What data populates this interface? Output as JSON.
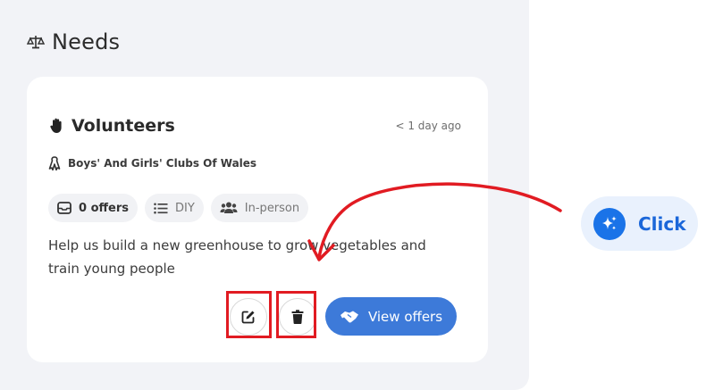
{
  "section": {
    "title": "Needs",
    "icon": "scale-icon"
  },
  "card": {
    "title": "Volunteers",
    "title_icon": "raised-hand-icon",
    "time": "< 1 day ago",
    "organization": "Boys' And Girls' Clubs Of Wales",
    "organization_icon": "ribbon-icon",
    "chips": [
      {
        "label": "0 offers",
        "icon": "inbox-icon"
      },
      {
        "label": "DIY",
        "icon": "list-icon"
      },
      {
        "label": "In-person",
        "icon": "people-icon"
      }
    ],
    "description": "Help us build a new greenhouse to grow vegetables and train young people",
    "actions": {
      "edit_icon": "edit-icon",
      "delete_icon": "trash-icon",
      "view_offers_label": "View offers",
      "view_offers_icon": "handshake-icon"
    }
  },
  "annotation": {
    "label": "Click",
    "icon": "sparkle-icon",
    "highlight_color": "#e11b22",
    "arrow_color": "#e11b22"
  },
  "colors": {
    "primary": "#3d7ad9",
    "panel_bg": "#f2f3f7"
  }
}
